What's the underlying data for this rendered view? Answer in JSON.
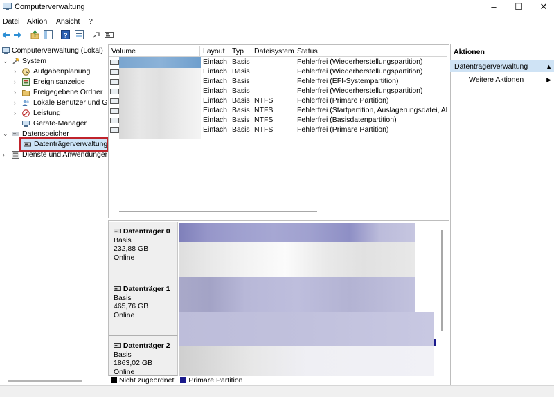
{
  "window": {
    "title": "Computerverwaltung",
    "minimize": "–",
    "maximize": "☐",
    "close": "✕"
  },
  "menu": {
    "items": [
      "Datei",
      "Aktion",
      "Ansicht",
      "?"
    ]
  },
  "tree": {
    "root": "Computerverwaltung (Lokal)",
    "system": "System",
    "aufgabenplanung": "Aufgabenplanung",
    "ereignisanzeige": "Ereignisanzeige",
    "freigegebene_ordner": "Freigegebene Ordner",
    "lokale_benutzer": "Lokale Benutzer und Gr",
    "leistung": "Leistung",
    "geraete_manager": "Geräte-Manager",
    "datenspeicher": "Datenspeicher",
    "datentraegerverwaltung": "Datenträgerverwaltung",
    "dienste": "Dienste und Anwendungen"
  },
  "table": {
    "columns": [
      "Volume",
      "Layout",
      "Typ",
      "Dateisystem",
      "Status"
    ],
    "rows": [
      [
        "",
        "Einfach",
        "Basis",
        "",
        "Fehlerfrei (Wiederherstellungspartition)"
      ],
      [
        "",
        "Einfach",
        "Basis",
        "",
        "Fehlerfrei (Wiederherstellungspartition)"
      ],
      [
        "",
        "Einfach",
        "Basis",
        "",
        "Fehlerfrei (EFI-Systempartition)"
      ],
      [
        "",
        "Einfach",
        "Basis",
        "",
        "Fehlerfrei (Wiederherstellungspartition)"
      ],
      [
        "",
        "Einfach",
        "Basis",
        "NTFS",
        "Fehlerfrei (Primäre Partition)"
      ],
      [
        "",
        "Einfach",
        "Basis",
        "NTFS",
        "Fehlerfrei (Startpartition, Auslagerungsdatei, Absturz"
      ],
      [
        "",
        "Einfach",
        "Basis",
        "NTFS",
        "Fehlerfrei (Basisdatenpartition)"
      ],
      [
        "",
        "Einfach",
        "Basis",
        "NTFS",
        "Fehlerfrei (Primäre Partition)"
      ]
    ]
  },
  "disks": [
    {
      "name": "Datenträger 0",
      "type": "Basis",
      "size": "232,88 GB",
      "state": "Online"
    },
    {
      "name": "Datenträger 1",
      "type": "Basis",
      "size": "465,76 GB",
      "state": "Online"
    },
    {
      "name": "Datenträger 2",
      "type": "Basis",
      "size": "1863,02 GB",
      "state": "Online"
    }
  ],
  "legend": {
    "unallocated": "Nicht zugeordnet",
    "primary": "Primäre Partition"
  },
  "actions": {
    "title": "Aktionen",
    "section": "Datenträgerverwaltung",
    "more": "Weitere Aktionen"
  },
  "colors": {
    "accent": "#0078d7",
    "selection_border": "#c0232b",
    "primary_partition": "#1a1a8c"
  }
}
